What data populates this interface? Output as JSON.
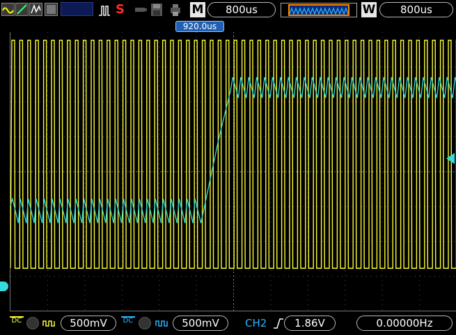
{
  "toolbar": {
    "run_stop_icon": "S",
    "horizontal_mode_letter": "M",
    "timebase": "800us",
    "window_letter": "W",
    "window_timebase": "800us"
  },
  "trigger_time_label": "920.0us",
  "channels": [
    {
      "coupling": "DC",
      "scale": "500mV",
      "color": "#ffff33"
    },
    {
      "coupling": "DC",
      "scale": "500mV",
      "color": "#33dddd"
    }
  ],
  "trigger": {
    "source": "CH2",
    "level": "1.86V",
    "frequency": "0.00000Hz"
  },
  "colors": {
    "ch1": "#ffff33",
    "ch2": "#33dddd",
    "accent_blue": "#29b6ff",
    "memory_window": "#ff8800"
  }
}
